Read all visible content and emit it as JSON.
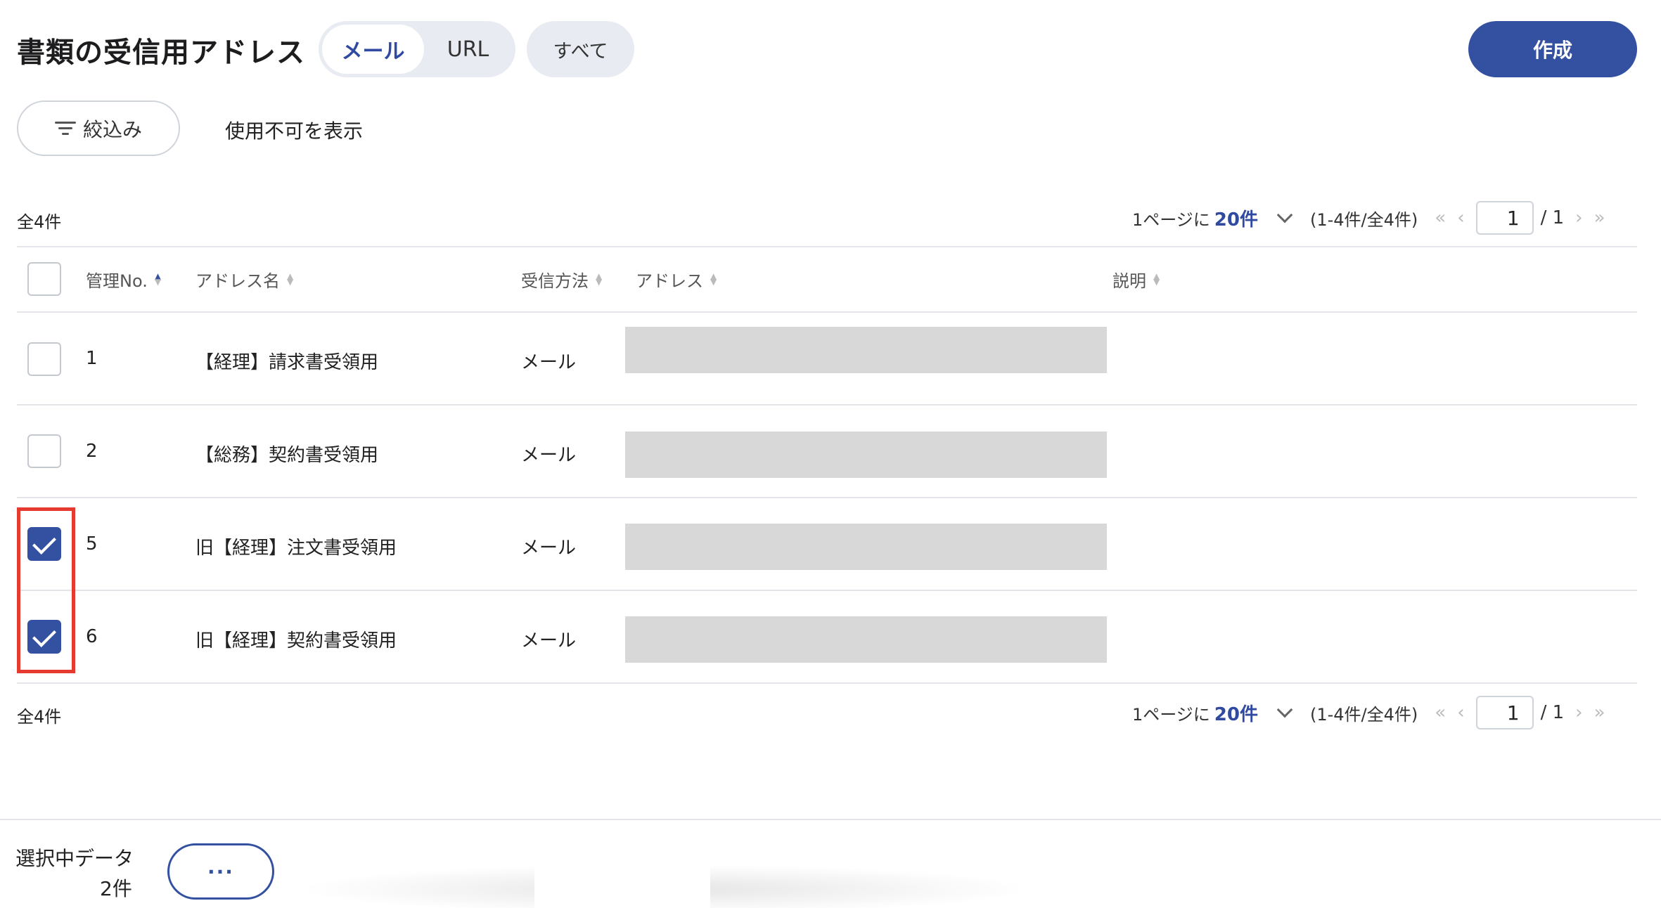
{
  "header": {
    "title": "書類の受信用アドレス",
    "tabs": [
      {
        "label": "メール",
        "active": true
      },
      {
        "label": "URL",
        "active": false
      }
    ],
    "all_label": "すべて",
    "create_label": "作成"
  },
  "filters": {
    "filter_label": "絞込み",
    "show_disabled_label": "使用不可を表示"
  },
  "summary": {
    "count_label": "全4件",
    "per_page_prefix": "1ページに",
    "per_page_value": "20件",
    "range_label": "(1-4件/全4件)",
    "current_page": "1",
    "total_pages": "/ 1"
  },
  "table": {
    "columns": [
      {
        "key": "no",
        "label": "管理No."
      },
      {
        "key": "name",
        "label": "アドレス名"
      },
      {
        "key": "method",
        "label": "受信方法"
      },
      {
        "key": "address",
        "label": "アドレス"
      },
      {
        "key": "description",
        "label": "説明"
      }
    ],
    "rows": [
      {
        "no": "1",
        "name": "【経理】請求書受領用",
        "method": "メール",
        "address": "",
        "description": "",
        "checked": false
      },
      {
        "no": "2",
        "name": "【総務】契約書受領用",
        "method": "メール",
        "address": "",
        "description": "",
        "checked": false
      },
      {
        "no": "5",
        "name": "旧【経理】注文書受領用",
        "method": "メール",
        "address": "",
        "description": "",
        "checked": true
      },
      {
        "no": "6",
        "name": "旧【経理】契約書受領用",
        "method": "メール",
        "address": "",
        "description": "",
        "checked": true
      }
    ]
  },
  "footer": {
    "selected_label": "選択中データ",
    "selected_count": "2件",
    "more_label": "···"
  },
  "colors": {
    "accent": "#3450a1",
    "highlight": "#e53a2f",
    "redacted": "#d8d8d8"
  }
}
